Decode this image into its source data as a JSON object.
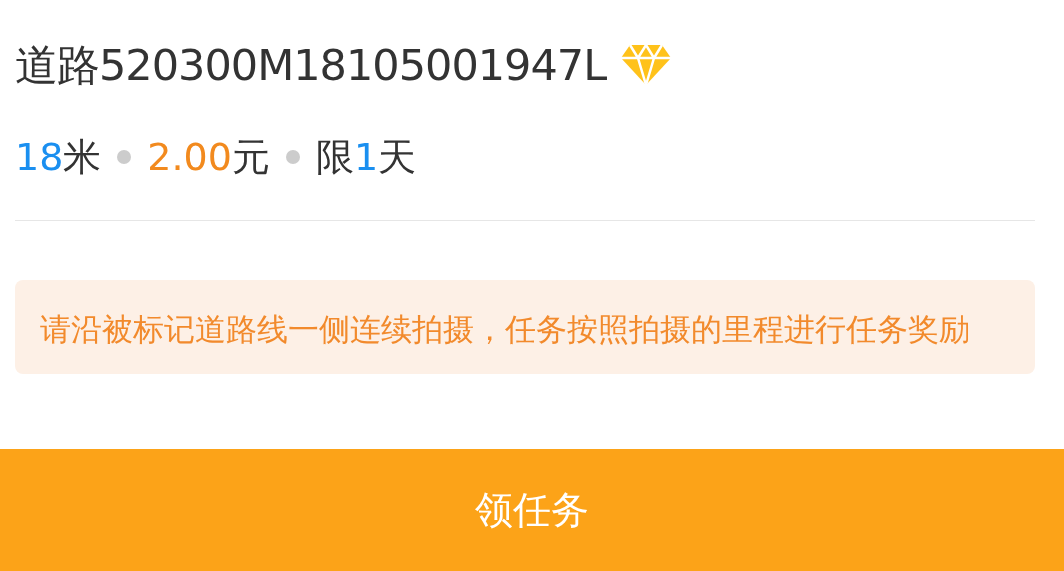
{
  "title": "道路520300M18105001947L",
  "meta": [
    {
      "kind": "blue",
      "value": "18",
      "unit": "米"
    },
    {
      "kind": "orange",
      "value": "2.00",
      "unit": "元"
    },
    {
      "kind": "blue",
      "prefix": "限",
      "value": "1",
      "unit": "天"
    }
  ],
  "notice": "请沿被标记道路线一侧连续拍摄，任务按照拍摄的里程进行任务奖励",
  "button": "领任务"
}
